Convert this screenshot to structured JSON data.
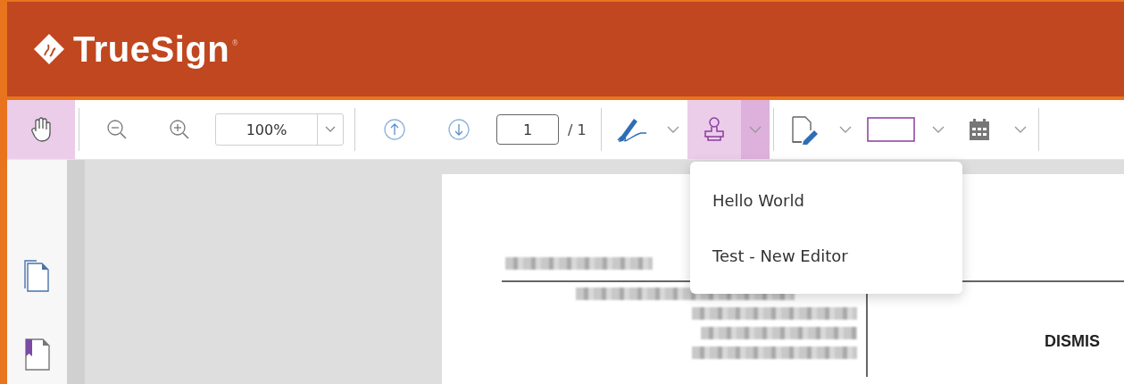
{
  "header": {
    "logo": "TrueSign",
    "mark": "®"
  },
  "toolbar": {
    "tools": [
      {
        "kind": "hand",
        "selected": true
      },
      {
        "kind": "sep"
      },
      {
        "kind": "zoom-out",
        "selected": false
      },
      {
        "kind": "zoom-in",
        "selected": false
      },
      {
        "kind": "zoom-select",
        "value": "100%"
      },
      {
        "kind": "sep"
      },
      {
        "kind": "page-up",
        "selected": false
      },
      {
        "kind": "page-down",
        "selected": false
      },
      {
        "kind": "page-field",
        "value": "1",
        "total": "/ 1"
      },
      {
        "kind": "sep"
      },
      {
        "kind": "signature",
        "selected": false,
        "expanded": false
      },
      {
        "kind": "stamp",
        "selected": true,
        "expanded": true
      },
      {
        "kind": "sep"
      },
      {
        "kind": "edit-doc",
        "selected": false,
        "expanded": false
      },
      {
        "kind": "rectangle",
        "selected": false,
        "expanded": false
      },
      {
        "kind": "calendar",
        "selected": false,
        "expanded": false
      },
      {
        "kind": "sep"
      }
    ]
  },
  "stamp_menu": {
    "items": [
      "Hello World",
      "Test - New Editor"
    ]
  },
  "document": {
    "heading": "DISMIS"
  }
}
